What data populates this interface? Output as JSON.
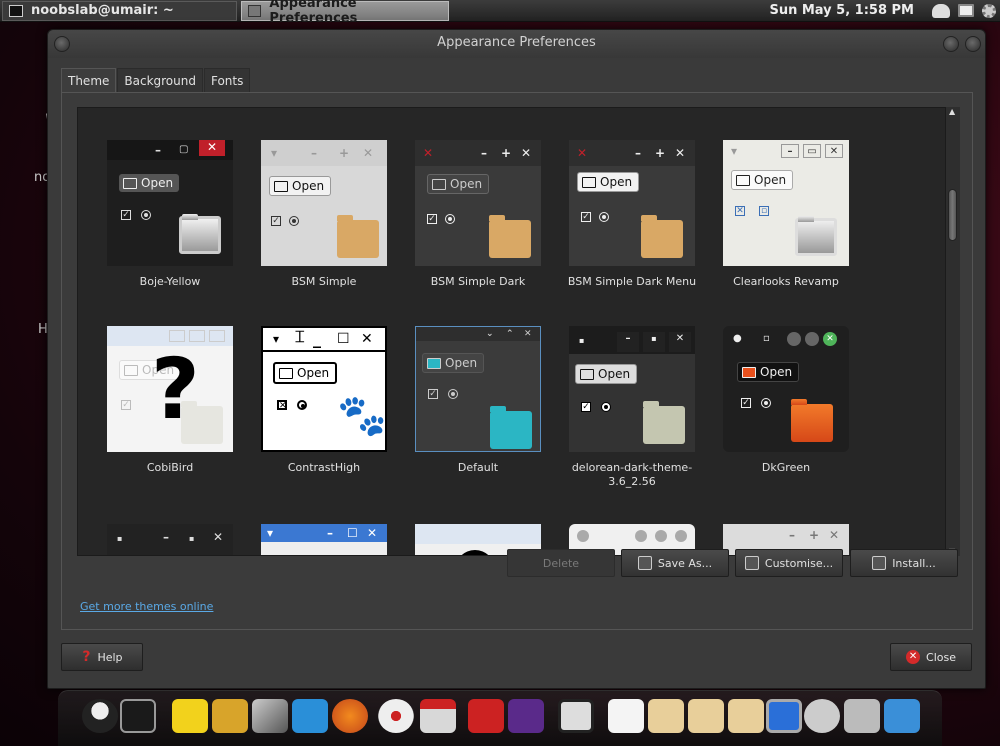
{
  "top_panel": {
    "tasks": [
      {
        "label": "noobslab@umair: ~"
      },
      {
        "label": "Appearance Preferences"
      }
    ],
    "clock": "Sun May  5,  1:58 PM",
    "tray_icons": [
      "camera-icon",
      "monitor-icon",
      "gear-icon"
    ]
  },
  "desktop": {
    "fragments": [
      "no",
      "H"
    ]
  },
  "window": {
    "title": "Appearance Preferences",
    "tabs": [
      "Theme",
      "Background",
      "Fonts"
    ],
    "active_tab": "Theme"
  },
  "themes": [
    {
      "name": "Boje-Yellow",
      "open": "Open"
    },
    {
      "name": "BSM Simple",
      "open": "Open"
    },
    {
      "name": "BSM Simple Dark",
      "open": "Open"
    },
    {
      "name": "BSM Simple Dark Menu",
      "open": "Open"
    },
    {
      "name": "Clearlooks Revamp",
      "open": "Open"
    },
    {
      "name": "CobiBird",
      "open": "Open"
    },
    {
      "name": "ContrastHigh",
      "open": "Open"
    },
    {
      "name": "Default",
      "open": "Open"
    },
    {
      "name": "delorean-dark-theme-3.6_2.56",
      "open": "Open"
    },
    {
      "name": "DkGreen",
      "open": "Open"
    }
  ],
  "actions": {
    "delete": "Delete",
    "save_as": "Save As...",
    "customise": "Customise...",
    "install": "Install...",
    "get_more": "Get more themes online"
  },
  "dialog_buttons": {
    "help": "Help",
    "close": "Close"
  },
  "dock_icons": [
    "tux-icon",
    "terminal-icon",
    "spongebob-icon",
    "cat-icon",
    "pen-icon",
    "owl-icon",
    "firefox-icon",
    "dvd-icon",
    "gmail-icon",
    "youtube-icon",
    "dancer-icon",
    "suit-icon",
    "home-icon",
    "folder-icon",
    "folder-clock-icon",
    "downloads-icon",
    "monitor-icon",
    "accessibility-icon",
    "speaker-icon",
    "network-icon"
  ],
  "colors": {
    "accent_link": "#5aa9e6",
    "close_red": "#d42a2a",
    "window_bg": "#3a3a3a"
  }
}
